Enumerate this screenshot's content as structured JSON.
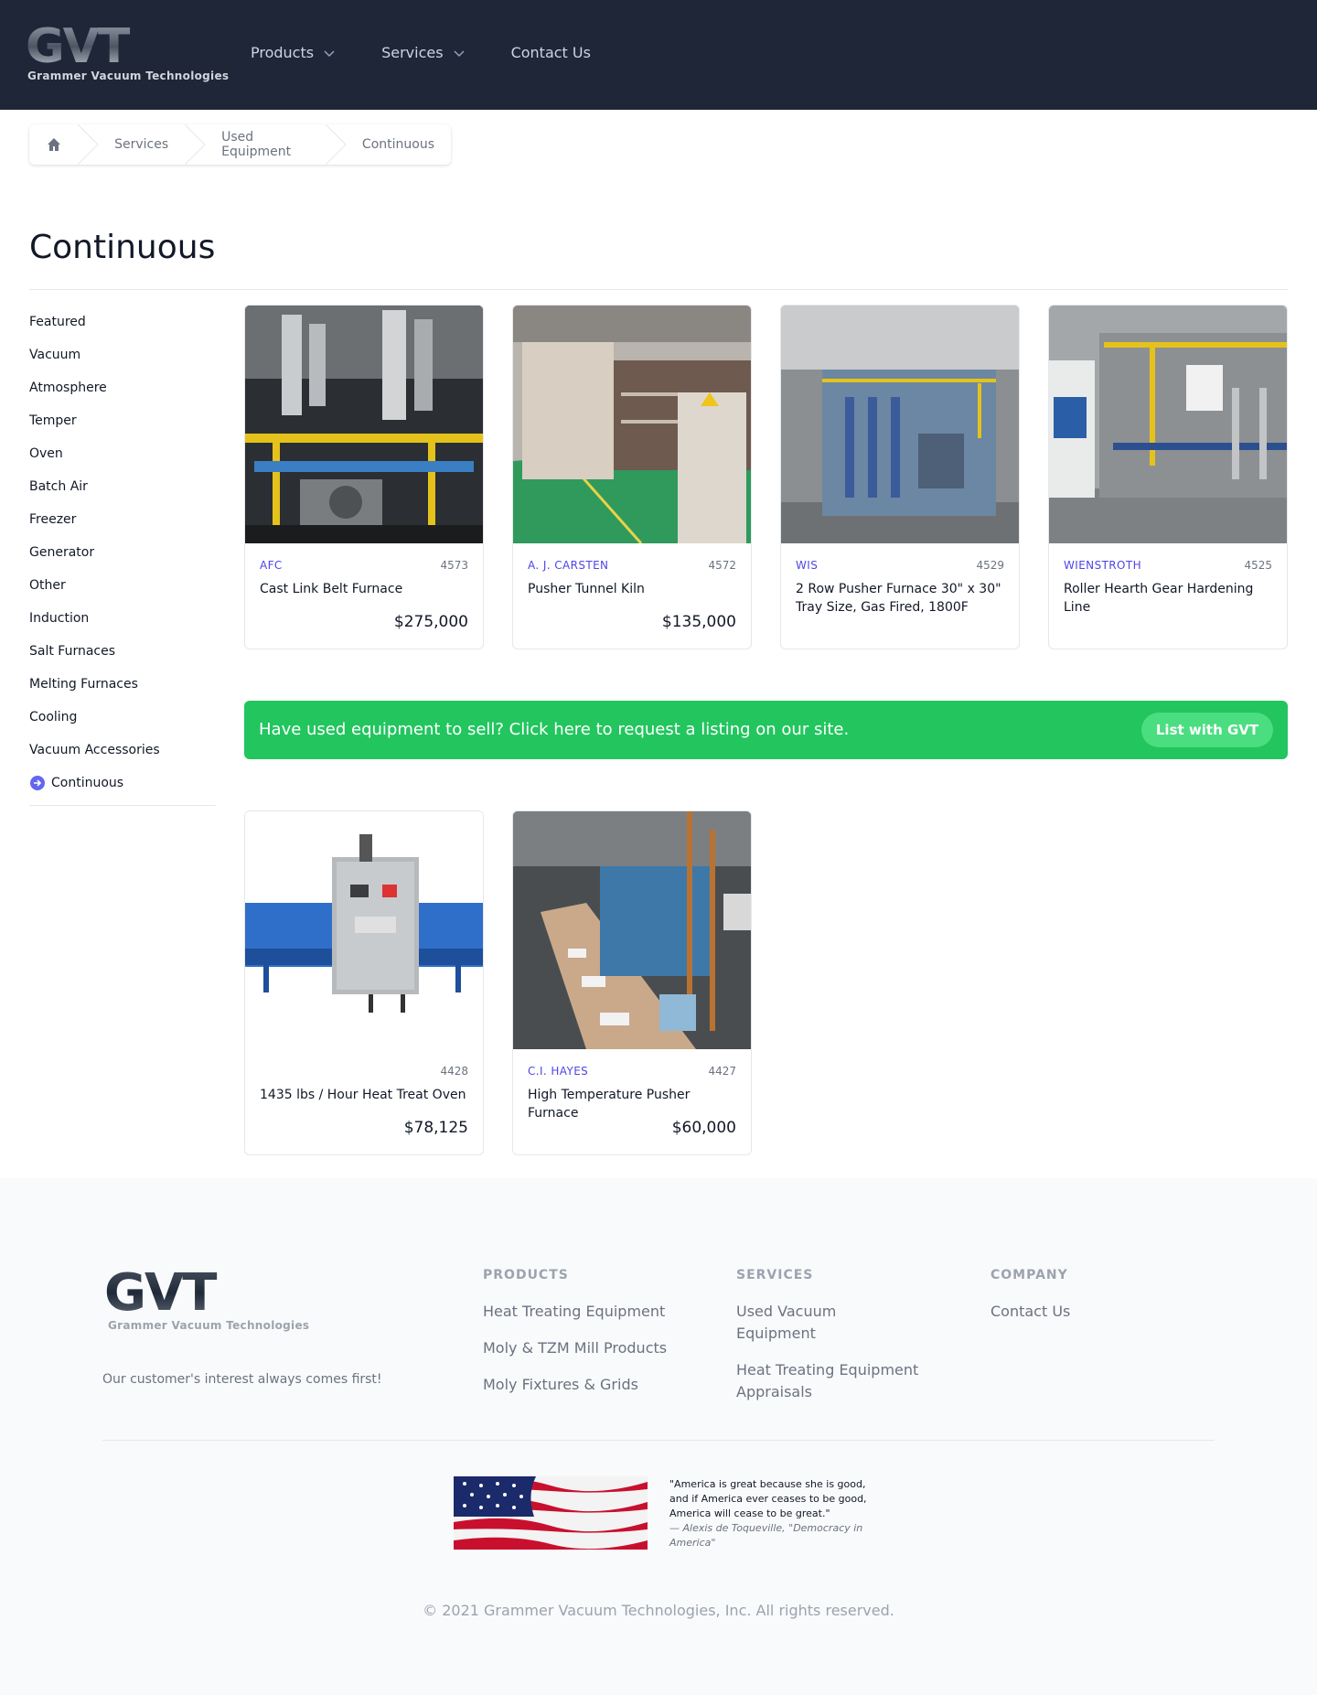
{
  "header": {
    "logo_text": "Grammer Vacuum Technologies",
    "nav": [
      {
        "label": "Products",
        "has_dropdown": true
      },
      {
        "label": "Services",
        "has_dropdown": true
      },
      {
        "label": "Contact Us",
        "has_dropdown": false
      }
    ]
  },
  "breadcrumb": {
    "home_icon": "home-icon",
    "items": [
      "Services",
      "Used Equipment",
      "Continuous"
    ]
  },
  "page": {
    "title": "Continuous"
  },
  "sidebar": {
    "items": [
      "Featured",
      "Vacuum",
      "Atmosphere",
      "Temper",
      "Oven",
      "Batch Air",
      "Freezer",
      "Generator",
      "Other",
      "Induction",
      "Salt Furnaces",
      "Melting Furnaces",
      "Cooling",
      "Vacuum Accessories",
      "Continuous"
    ],
    "active": "Continuous"
  },
  "listings": [
    {
      "brand": "AFC",
      "number": "4573",
      "name": "Cast Link Belt Furnace",
      "price": "$275,000"
    },
    {
      "brand": "A. J. CARSTEN",
      "number": "4572",
      "name": "Pusher Tunnel Kiln",
      "price": "$135,000"
    },
    {
      "brand": "WIS",
      "number": "4529",
      "name": "2 Row Pusher Furnace 30\" x 30\" Tray Size, Gas Fired, 1800F",
      "price": ""
    },
    {
      "brand": "WIENSTROTH",
      "number": "4525",
      "name": "Roller Hearth Gear Hardening Line",
      "price": ""
    },
    {
      "brand": "",
      "number": "4428",
      "name": "1435 lbs / Hour Heat Treat Oven",
      "price": "$78,125"
    },
    {
      "brand": "C.I. HAYES",
      "number": "4427",
      "name": "High Temperature Pusher Furnace",
      "price": "$60,000"
    }
  ],
  "banner": {
    "text": "Have used equipment to sell? Click here to request a listing on our site.",
    "button": "List with GVT"
  },
  "footer": {
    "logo_text": "Grammer Vacuum Technologies",
    "tagline": "Our customer's interest always comes first!",
    "products": {
      "heading": "PRODUCTS",
      "links": [
        "Heat Treating Equipment",
        "Moly & TZM Mill Products",
        "Moly Fixtures & Grids"
      ]
    },
    "services": {
      "heading": "SERVICES",
      "links": [
        "Used Vacuum Equipment",
        "Heat Treating Equipment Appraisals"
      ]
    },
    "company": {
      "heading": "COMPANY",
      "links": [
        "Contact Us"
      ]
    },
    "quote": "\"America is great because she is good, and if America ever ceases to be good, America will cease to be great.\"",
    "quote_attribution": "— Alexis de Toqueville, \"Democracy in America\"",
    "copyright": "© 2021 Grammer Vacuum Technologies, Inc. All rights reserved."
  },
  "colors": {
    "header_bg": "#1e2638",
    "brand_text": "#4f46e5",
    "banner_bg": "#22c55e",
    "banner_button": "#4ade80"
  }
}
